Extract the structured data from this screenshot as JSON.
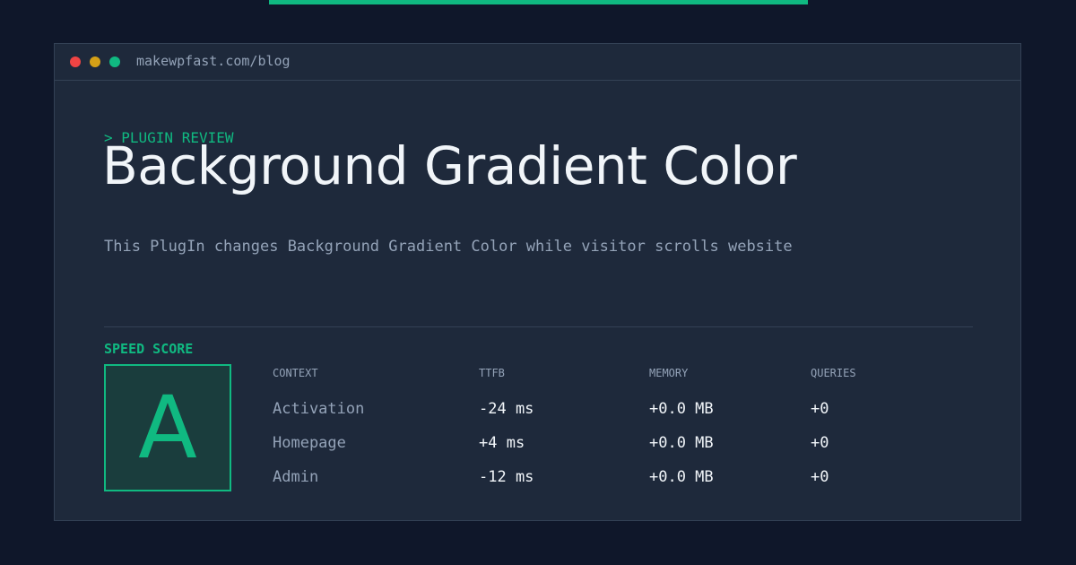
{
  "colors": {
    "background": "#0f172a",
    "panel": "#1e293b",
    "border": "#334155",
    "accent": "#10b981",
    "text_primary": "#f1f5f9",
    "text_muted": "#94a3b8",
    "dot_red": "#ef4444",
    "dot_yellow": "#d4a017",
    "dot_green": "#10b981"
  },
  "window": {
    "url": "makewpfast.com/blog",
    "dots": [
      "red",
      "yellow",
      "green"
    ]
  },
  "article": {
    "eyebrow": "> PLUGIN REVIEW",
    "title": "Background Gradient Color",
    "description": "This PlugIn changes Background Gradient Color while visitor scrolls website"
  },
  "speed": {
    "label": "SPEED SCORE",
    "grade": "A"
  },
  "table": {
    "headers": [
      "CONTEXT",
      "TTFB",
      "MEMORY",
      "QUERIES"
    ],
    "rows": [
      [
        "Activation",
        "-24 ms",
        "+0.0 MB",
        "+0"
      ],
      [
        "Homepage",
        "+4 ms",
        "+0.0 MB",
        "+0"
      ],
      [
        "Admin",
        "-12 ms",
        "+0.0 MB",
        "+0"
      ]
    ]
  }
}
